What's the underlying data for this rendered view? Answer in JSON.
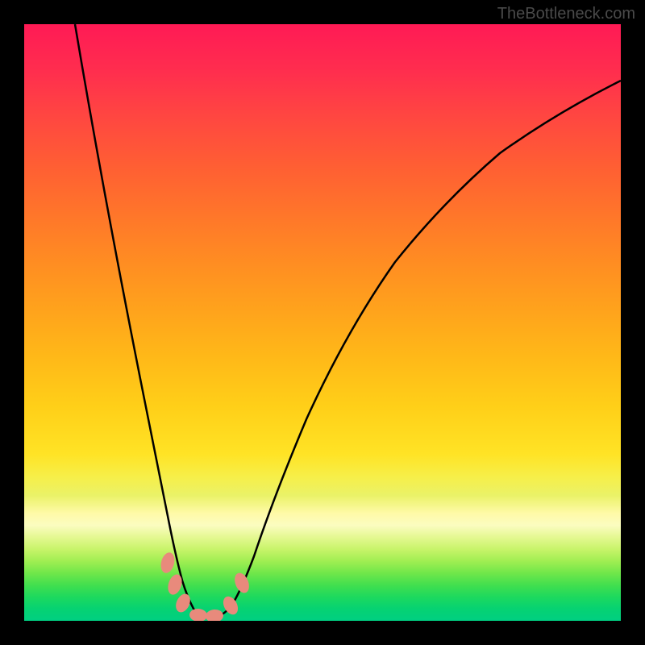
{
  "watermark": "TheBottleneck.com",
  "chart_data": {
    "type": "line",
    "title": "",
    "xlabel": "",
    "ylabel": "",
    "xlim": [
      0,
      100
    ],
    "ylim": [
      0,
      100
    ],
    "series": [
      {
        "name": "curve",
        "x": [
          9,
          12,
          15,
          18,
          20,
          22,
          24,
          25,
          26,
          27,
          28,
          29,
          30,
          32,
          34,
          36,
          40,
          45,
          50,
          55,
          60,
          65,
          70,
          75,
          80,
          85,
          90,
          95,
          100
        ],
        "y": [
          100,
          85,
          70,
          56,
          45,
          35,
          25,
          18,
          12,
          7,
          4,
          2,
          1,
          1,
          2,
          5,
          15,
          30,
          42,
          52,
          60,
          67,
          73,
          78,
          82,
          85,
          88,
          90,
          92
        ]
      }
    ],
    "beads": [
      {
        "x": 24.5,
        "y": 9
      },
      {
        "x": 25.5,
        "y": 6
      },
      {
        "x": 26.5,
        "y": 3.5
      },
      {
        "x": 29,
        "y": 1
      },
      {
        "x": 31.5,
        "y": 1
      },
      {
        "x": 34.5,
        "y": 4
      },
      {
        "x": 36,
        "y": 9
      }
    ],
    "gradient_stops": [
      {
        "pos": 0,
        "color": "#ff1a55"
      },
      {
        "pos": 50,
        "color": "#ffa31c"
      },
      {
        "pos": 80,
        "color": "#fffaa8"
      },
      {
        "pos": 100,
        "color": "#00cf82"
      }
    ]
  }
}
